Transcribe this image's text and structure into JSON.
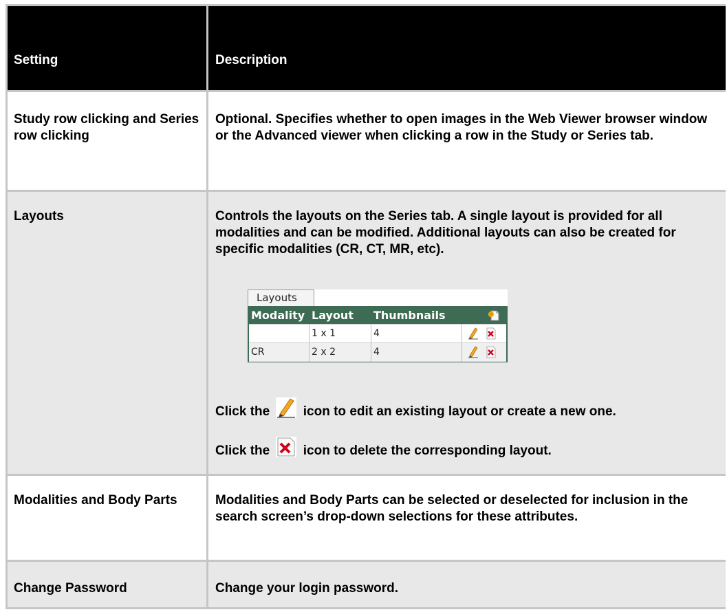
{
  "table": {
    "header": {
      "setting": "Setting",
      "description": "Description"
    },
    "rows": [
      {
        "setting": "Study row clicking and Series row clicking",
        "description": "Optional. Specifies whether to open images in the Web Viewer browser window or the Advanced viewer when clicking a row in the Study or Series tab."
      },
      {
        "setting": "Layouts",
        "description": "Controls the layouts on the Series tab. A single layout is provided for all modalities and can be modified. Additional layouts can also be created for specific modalities (CR, CT, MR, etc).",
        "edit_prefix": "Click the",
        "edit_suffix": "icon to edit an existing layout or create a new one.",
        "delete_prefix": "Click the",
        "delete_suffix": "icon to delete the corresponding layout."
      },
      {
        "setting": "Modalities and Body Parts",
        "description": "Modalities and Body Parts can be selected or deselected for inclusion in the search screen’s drop-down selections for these attributes."
      },
      {
        "setting": "Change Password",
        "description": "Change your login password."
      }
    ]
  },
  "layouts_widget": {
    "tab_label": "Layouts",
    "columns": [
      "Modality",
      "Layout",
      "Thumbnails"
    ],
    "add_icon": "add-layout-icon",
    "rows": [
      {
        "modality": "",
        "layout": "1 x 1",
        "thumbnails": "4"
      },
      {
        "modality": "CR",
        "layout": "2 x 2",
        "thumbnails": "4"
      }
    ],
    "colors": {
      "header_bg": "#3d6b54",
      "header_text": "#ffffff"
    }
  },
  "colors": {
    "header_bg": "#000000",
    "row_alt_bg": "#e8e8e8",
    "grid": "#c6c6c6"
  }
}
